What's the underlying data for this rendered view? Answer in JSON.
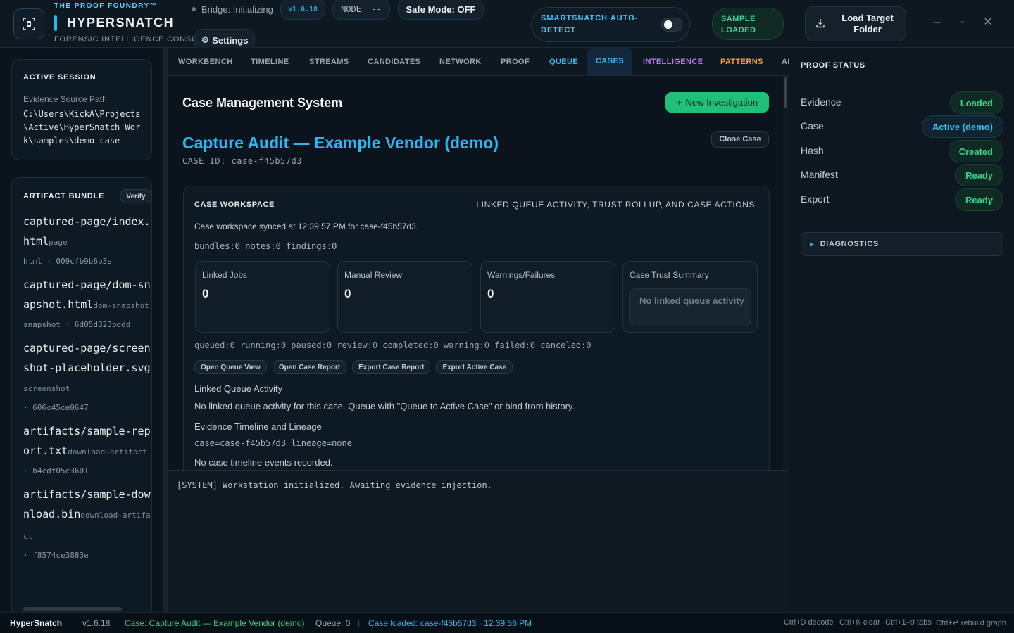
{
  "header": {
    "kicker": "THE PROOF FOUNDRY™",
    "app_name": "HYPERSNATCH",
    "subtitle": "FORENSIC INTELLIGENCE CONSOLE",
    "bridge_status": "Bridge: Initializing",
    "version_badge": "v1.6.18",
    "node_label": "NODE  --",
    "safe_mode": "Safe Mode: OFF",
    "settings_label": "Settings",
    "smartsnatch_label": "SMARTSNATCH AUTO-DETECT",
    "smartsnatch_enabled": false,
    "sample_status": "SAMPLE LOADED",
    "load_target_label": "Load Target Folder"
  },
  "session": {
    "title": "ACTIVE SESSION",
    "source_label": "Evidence Source Path",
    "source_path": "C:\\Users\\KickA\\Projects\\Active\\HyperSnatch_Work\\samples\\demo-case"
  },
  "bundle": {
    "title": "ARTIFACT BUNDLE",
    "verify_label": "Verify",
    "artifacts": [
      {
        "name": "captured-page/index.html",
        "kind": "page",
        "meta": "html · 009cfb9b6b3e"
      },
      {
        "name": "captured-page/dom-snapshot.html",
        "kind": "dom-snapshot",
        "meta": "snapshot · 6d05d823bddd"
      },
      {
        "name": "captured-page/screenshot-placeholder.svg",
        "kind": "screenshot",
        "meta": "· 606c45ce0647"
      },
      {
        "name": "artifacts/sample-report.txt",
        "kind": "download-artifact",
        "meta": "· b4cdf05c3601"
      },
      {
        "name": "artifacts/sample-download.bin",
        "kind": "download-artifact",
        "meta": "· f8574ce3883e"
      }
    ]
  },
  "tabs": [
    {
      "label": "WORKBENCH",
      "color": "#9aa7b1"
    },
    {
      "label": "TIMELINE",
      "color": "#9aa7b1"
    },
    {
      "label": "STREAMS",
      "color": "#9aa7b1"
    },
    {
      "label": "CANDIDATES",
      "color": "#9aa7b1"
    },
    {
      "label": "NETWORK",
      "color": "#9aa7b1"
    },
    {
      "label": "PROOF",
      "color": "#9aa7b1"
    },
    {
      "label": "QUEUE",
      "color": "#3fb4f0"
    },
    {
      "label": "CASES",
      "color": "#3fb4f0",
      "active": true
    },
    {
      "label": "INTELLIGENCE",
      "color": "#b37cf2"
    },
    {
      "label": "PATTERNS",
      "color": "#f0a03c"
    },
    {
      "label": "AI",
      "color": "#9aa7b1"
    }
  ],
  "main": {
    "page_title": "Case Management System",
    "new_investigation_label": "New Investigation",
    "case_title": "Capture Audit — Example Vendor (demo)",
    "close_case_label": "Close Case",
    "case_id": "CASE ID: case-f45b57d3",
    "workspace": {
      "title": "CASE WORKSPACE",
      "subtitle": "LINKED QUEUE ACTIVITY, TRUST ROLLUP, AND CASE ACTIONS.",
      "sync_text": "Case workspace synced at 12:39:57 PM for case-f45b57d3.",
      "counts": "bundles:0 notes:0 findings:0",
      "stats": [
        {
          "label": "Linked Jobs",
          "value": "0"
        },
        {
          "label": "Manual Review",
          "value": "0"
        },
        {
          "label": "Warnings/Failures",
          "value": "0"
        }
      ],
      "trust_label": "Case Trust Summary",
      "trust_value": "No linked queue activity",
      "queue_counts": "queued:0 running:0 paused:0 review:0 completed:0 warning:0 failed:0 canceled:0",
      "actions": [
        "Open Queue View",
        "Open Case Report",
        "Export Case Report",
        "Export Active Case"
      ],
      "linked_heading": "Linked Queue Activity",
      "linked_text": "No linked queue activity for this case. Queue with \"Queue to Active Case\" or bind from history.",
      "timeline_heading": "Evidence Timeline and Lineage",
      "timeline_meta": "case=case-f45b57d3 lineage=none",
      "timeline_text": "No case timeline events recorded."
    }
  },
  "console": {
    "line": "[SYSTEM] Workstation initialized. Awaiting evidence injection."
  },
  "proof": {
    "title": "PROOF STATUS",
    "rows": [
      {
        "key": "Evidence",
        "value": "Loaded"
      },
      {
        "key": "Case",
        "value": "Active (demo)"
      },
      {
        "key": "Hash",
        "value": "Created"
      },
      {
        "key": "Manifest",
        "value": "Ready"
      },
      {
        "key": "Export",
        "value": "Ready"
      }
    ],
    "diagnostics_label": "DIAGNOSTICS"
  },
  "statusbar": {
    "app": "HyperSnatch",
    "version": "v1.6.18",
    "case": "Case: Capture Audit — Example Vendor (demo)",
    "queue": "Queue: 0",
    "loaded": "Case loaded: case-f45b57d3 · 12:39:56 PM",
    "shortcuts": [
      "Ctrl+D decode",
      "Ctrl+K clear",
      "Ctrl+1–9 tabs",
      "Ctrl+↵ rebuild graph"
    ]
  }
}
